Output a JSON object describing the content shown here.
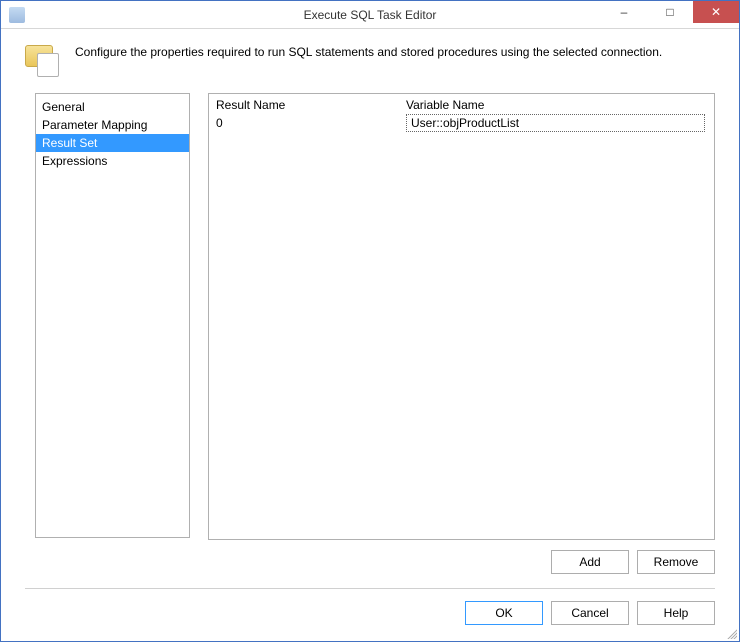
{
  "window": {
    "title": "Execute SQL Task Editor",
    "minimize": "–",
    "maximize": "□",
    "close": "✕"
  },
  "header": {
    "description": "Configure the properties required to run SQL statements and stored procedures using the selected connection."
  },
  "nav": {
    "items": [
      {
        "label": "General",
        "selected": false
      },
      {
        "label": "Parameter Mapping",
        "selected": false
      },
      {
        "label": "Result Set",
        "selected": true
      },
      {
        "label": "Expressions",
        "selected": false
      }
    ]
  },
  "grid": {
    "columns": {
      "result_name": "Result Name",
      "variable_name": "Variable Name"
    },
    "rows": [
      {
        "result_name": "0",
        "variable_name": "User::objProductList"
      }
    ]
  },
  "buttons": {
    "add": "Add",
    "remove": "Remove",
    "ok": "OK",
    "cancel": "Cancel",
    "help": "Help"
  }
}
